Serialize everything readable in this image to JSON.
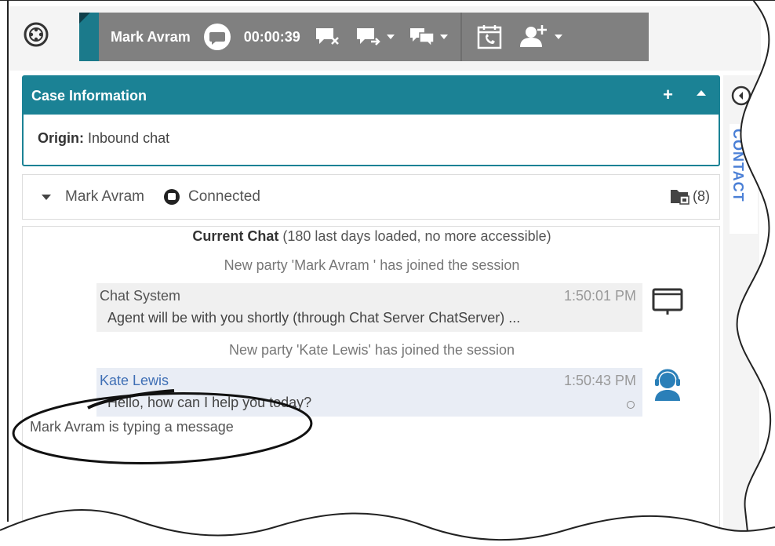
{
  "toolbar": {
    "contact_name": "Mark Avram",
    "timer": "00:00:39"
  },
  "case": {
    "title": "Case Information",
    "add_label": "+",
    "origin_label": "Origin:",
    "origin_value": "Inbound chat"
  },
  "side": {
    "tab_label": "CONTACT"
  },
  "party": {
    "name": "Mark Avram",
    "status": "Connected",
    "folder_count": "(8)"
  },
  "transcript": {
    "history_bold": "Current Chat",
    "history_rest": " (180 last days loaded, no more accessible)",
    "notice_1": "New party 'Mark Avram ' has joined the session",
    "notice_2": "New party 'Kate Lewis' has joined the session",
    "messages": [
      {
        "author": "Chat System",
        "time": "1:50:01 PM",
        "text": "Agent will be with you shortly (through Chat Server ChatServer) ..."
      },
      {
        "author": "Kate Lewis",
        "time": "1:50:43 PM",
        "text": "Hello, how can I help you today?"
      }
    ],
    "typing": "Mark Avram  is typing a message"
  },
  "colors": {
    "accent": "#1b8295",
    "toolbar_bg": "#808080",
    "agent_blue": "#3f6fb5"
  },
  "icons": [
    "app-logo-icon",
    "chat-icon",
    "end-chat-icon",
    "transfer-icon",
    "conference-icon",
    "schedule-callback-icon",
    "consult-agent-icon",
    "folder-icon",
    "agent-headset-icon",
    "monitor-icon"
  ]
}
